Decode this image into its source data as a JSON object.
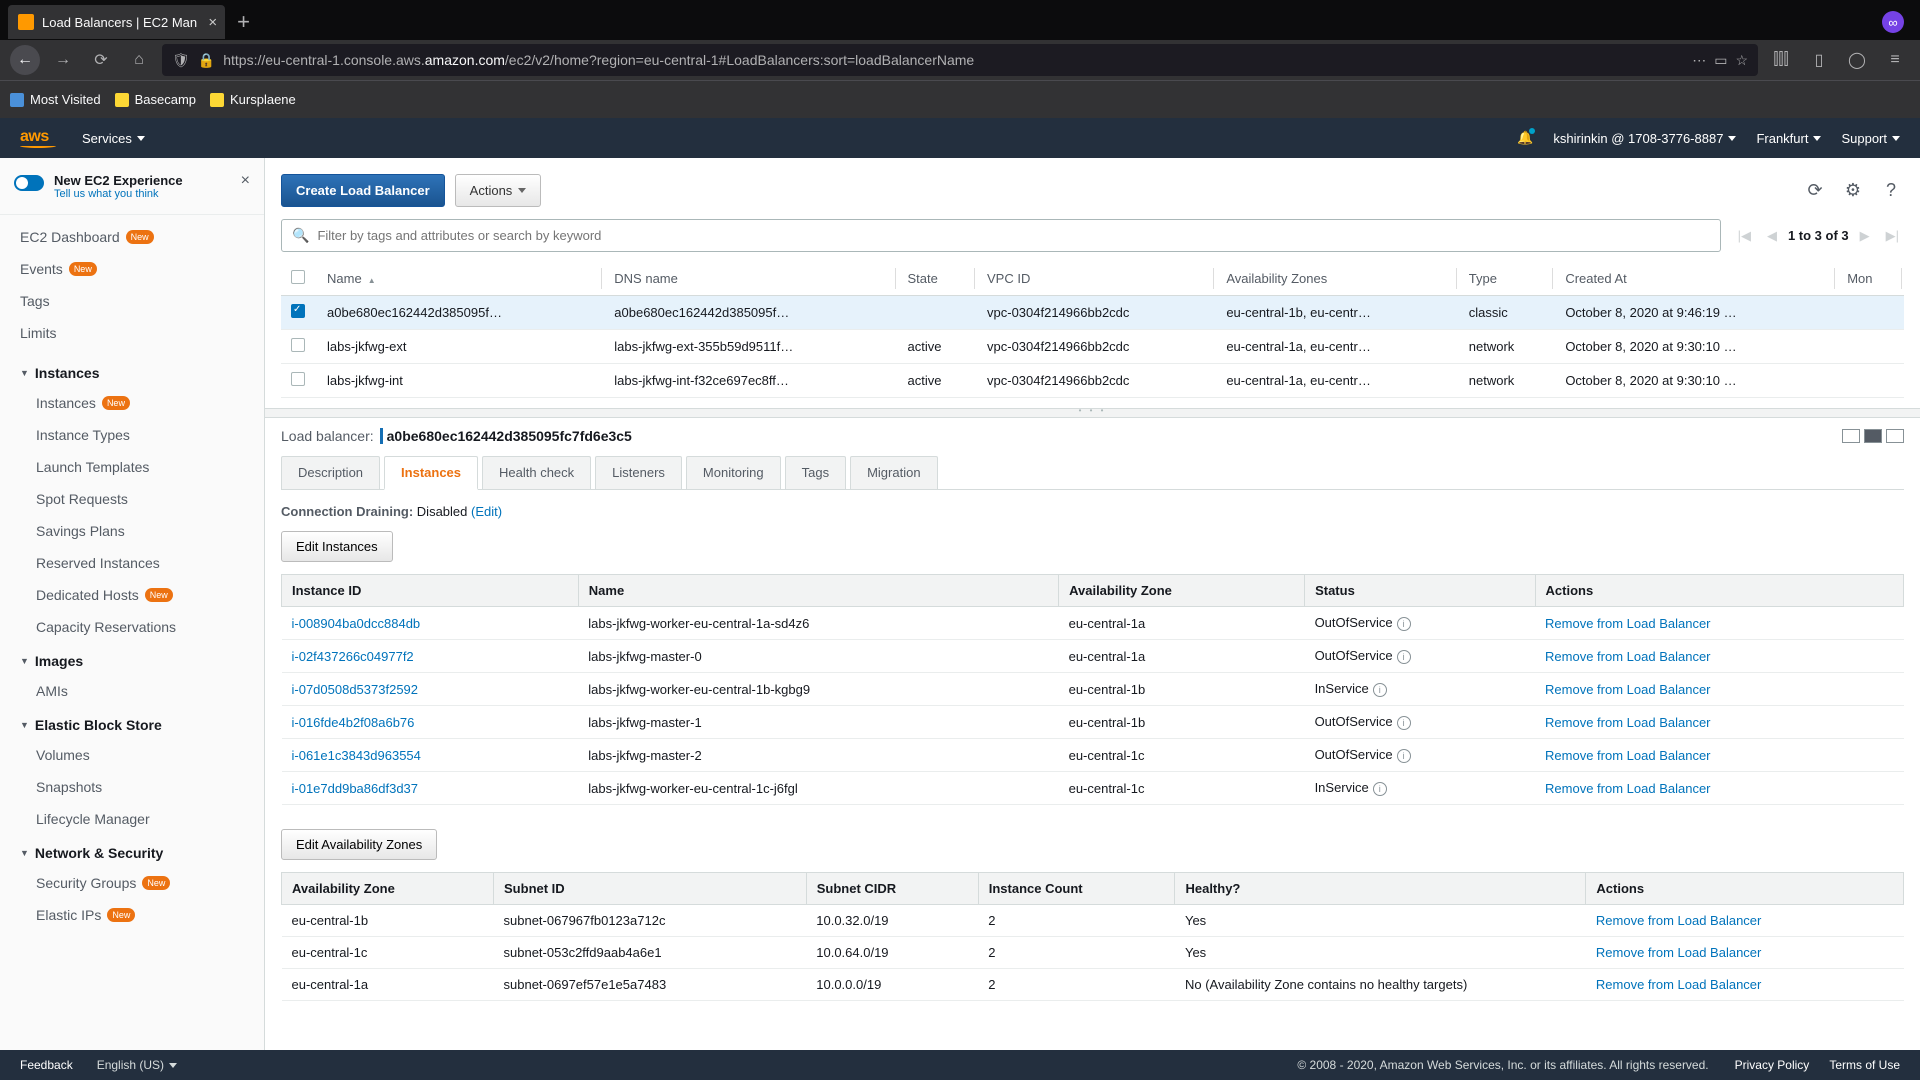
{
  "browser": {
    "tab_title": "Load Balancers | EC2 Man",
    "url_prefix": "https://eu-central-1.console.aws.",
    "url_domain": "amazon.com",
    "url_path": "/ec2/v2/home?region=eu-central-1#LoadBalancers:sort=loadBalancerName",
    "bookmarks": [
      "Most Visited",
      "Basecamp",
      "Kursplaene"
    ]
  },
  "header": {
    "services_label": "Services",
    "account_label": "kshirinkin @ 1708-3776-8887",
    "region_label": "Frankfurt",
    "support_label": "Support"
  },
  "sidebar": {
    "banner": {
      "title": "New EC2 Experience",
      "subtitle": "Tell us what you think"
    },
    "top_items": [
      "EC2 Dashboard",
      "Events",
      "Tags",
      "Limits"
    ],
    "top_badges": {
      "0": "New",
      "1": "New"
    },
    "groups": [
      {
        "title": "Instances",
        "items": [
          "Instances",
          "Instance Types",
          "Launch Templates",
          "Spot Requests",
          "Savings Plans",
          "Reserved Instances",
          "Dedicated Hosts",
          "Capacity Reservations"
        ],
        "badges": {
          "0": "New",
          "6": "New"
        }
      },
      {
        "title": "Images",
        "items": [
          "AMIs"
        ]
      },
      {
        "title": "Elastic Block Store",
        "items": [
          "Volumes",
          "Snapshots",
          "Lifecycle Manager"
        ]
      },
      {
        "title": "Network & Security",
        "items": [
          "Security Groups",
          "Elastic IPs"
        ],
        "badges": {
          "0": "New",
          "1": "New"
        }
      }
    ]
  },
  "toolbar": {
    "create_label": "Create Load Balancer",
    "actions_label": "Actions"
  },
  "search": {
    "placeholder": "Filter by tags and attributes or search by keyword"
  },
  "pager": {
    "text": "1 to 3 of 3"
  },
  "lb_table": {
    "headers": [
      "Name",
      "DNS name",
      "State",
      "VPC ID",
      "Availability Zones",
      "Type",
      "Created At",
      "Mon"
    ],
    "rows": [
      {
        "selected": true,
        "name": "a0be680ec162442d385095f…",
        "dns": "a0be680ec162442d385095f…",
        "state": "",
        "vpc": "vpc-0304f214966bb2cdc",
        "az": "eu-central-1b, eu-centr…",
        "type": "classic",
        "created": "October 8, 2020 at 9:46:19 …"
      },
      {
        "selected": false,
        "name": "labs-jkfwg-ext",
        "dns": "labs-jkfwg-ext-355b59d9511f…",
        "state": "active",
        "vpc": "vpc-0304f214966bb2cdc",
        "az": "eu-central-1a, eu-centr…",
        "type": "network",
        "created": "October 8, 2020 at 9:30:10 …"
      },
      {
        "selected": false,
        "name": "labs-jkfwg-int",
        "dns": "labs-jkfwg-int-f32ce697ec8ff…",
        "state": "active",
        "vpc": "vpc-0304f214966bb2cdc",
        "az": "eu-central-1a, eu-centr…",
        "type": "network",
        "created": "October 8, 2020 at 9:30:10 …"
      }
    ]
  },
  "detail": {
    "label": "Load balancer:",
    "name": "a0be680ec162442d385095fc7fd6e3c5",
    "tabs": [
      "Description",
      "Instances",
      "Health check",
      "Listeners",
      "Monitoring",
      "Tags",
      "Migration"
    ],
    "active_tab": 1,
    "conn_draining_label": "Connection Draining:",
    "conn_draining_value": "Disabled",
    "conn_draining_edit": "(Edit)",
    "edit_instances_btn": "Edit Instances",
    "instances_table": {
      "headers": [
        "Instance ID",
        "Name",
        "Availability Zone",
        "Status",
        "Actions"
      ],
      "rows": [
        {
          "id": "i-008904ba0dcc884db",
          "name": "labs-jkfwg-worker-eu-central-1a-sd4z6",
          "az": "eu-central-1a",
          "status": "OutOfService",
          "action": "Remove from Load Balancer"
        },
        {
          "id": "i-02f437266c04977f2",
          "name": "labs-jkfwg-master-0",
          "az": "eu-central-1a",
          "status": "OutOfService",
          "action": "Remove from Load Balancer"
        },
        {
          "id": "i-07d0508d5373f2592",
          "name": "labs-jkfwg-worker-eu-central-1b-kgbg9",
          "az": "eu-central-1b",
          "status": "InService",
          "action": "Remove from Load Balancer"
        },
        {
          "id": "i-016fde4b2f08a6b76",
          "name": "labs-jkfwg-master-1",
          "az": "eu-central-1b",
          "status": "OutOfService",
          "action": "Remove from Load Balancer"
        },
        {
          "id": "i-061e1c3843d963554",
          "name": "labs-jkfwg-master-2",
          "az": "eu-central-1c",
          "status": "OutOfService",
          "action": "Remove from Load Balancer"
        },
        {
          "id": "i-01e7dd9ba86df3d37",
          "name": "labs-jkfwg-worker-eu-central-1c-j6fgl",
          "az": "eu-central-1c",
          "status": "InService",
          "action": "Remove from Load Balancer"
        }
      ]
    },
    "edit_az_btn": "Edit Availability Zones",
    "az_table": {
      "headers": [
        "Availability Zone",
        "Subnet ID",
        "Subnet CIDR",
        "Instance Count",
        "Healthy?",
        "Actions"
      ],
      "rows": [
        {
          "az": "eu-central-1b",
          "subnet": "subnet-067967fb0123a712c",
          "cidr": "10.0.32.0/19",
          "count": "2",
          "healthy": "Yes",
          "action": "Remove from Load Balancer"
        },
        {
          "az": "eu-central-1c",
          "subnet": "subnet-053c2ffd9aab4a6e1",
          "cidr": "10.0.64.0/19",
          "count": "2",
          "healthy": "Yes",
          "action": "Remove from Load Balancer"
        },
        {
          "az": "eu-central-1a",
          "subnet": "subnet-0697ef57e1e5a7483",
          "cidr": "10.0.0.0/19",
          "count": "2",
          "healthy": "No (Availability Zone contains no healthy targets)",
          "action": "Remove from Load Balancer"
        }
      ]
    }
  },
  "footer": {
    "feedback": "Feedback",
    "language": "English (US)",
    "copyright": "© 2008 - 2020, Amazon Web Services, Inc. or its affiliates. All rights reserved.",
    "privacy": "Privacy Policy",
    "terms": "Terms of Use"
  }
}
